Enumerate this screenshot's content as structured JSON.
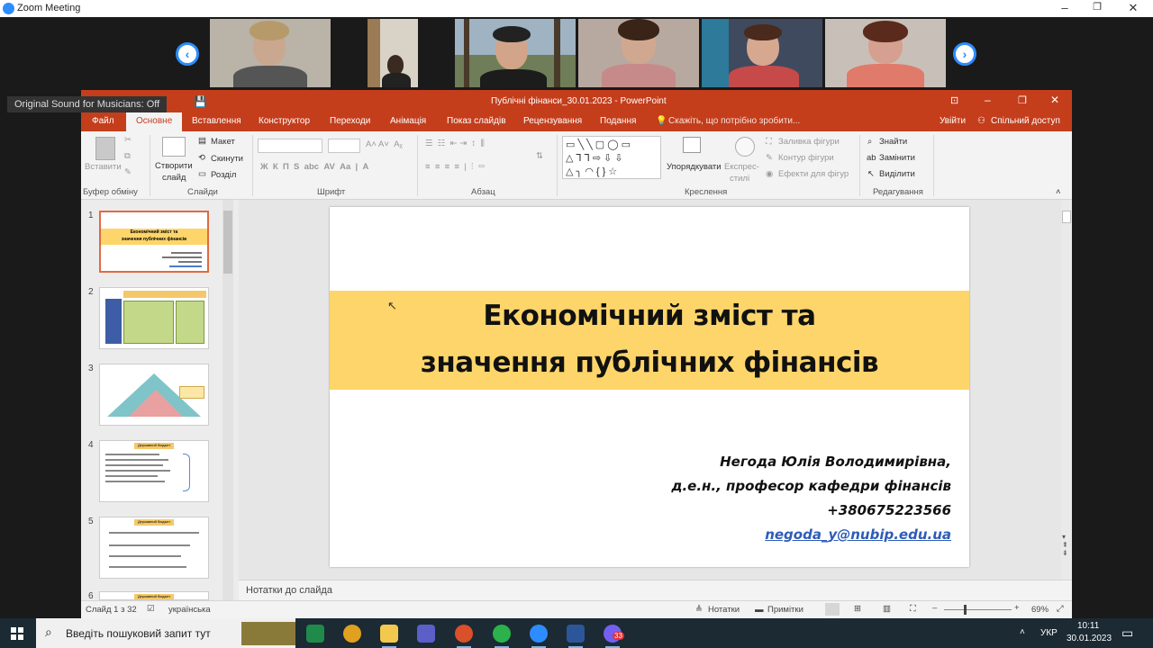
{
  "zoom": {
    "title": "Zoom Meeting",
    "win_min": "–",
    "win_max": "❐",
    "win_close": "✕",
    "prev": "‹",
    "next": "›",
    "tooltip": "Original Sound for Musicians: Off"
  },
  "ppt": {
    "title": "Публічні фінанси_30.01.2023  -  PowerPoint",
    "tabs": [
      "Файл",
      "Основне",
      "Вставлення",
      "Конструктор",
      "Переходи",
      "Анімація",
      "Показ слайдів",
      "Рецензування",
      "Подання"
    ],
    "tell_me": "Скажіть, що потрібно зробити...",
    "sign_in": "Увійти",
    "share": "Спільний доступ",
    "ribbon": {
      "paste": "Вставити",
      "clipboard_group": "Буфер обміну",
      "new_slide_1": "Створити",
      "new_slide_2": "слайд",
      "layout": "Макет",
      "reset": "Скинути",
      "section": "Розділ",
      "slides_group": "Слайди",
      "font_group": "Шрифт",
      "paragraph_group": "Абзац",
      "arrange": "Упорядкувати",
      "quick_styles_1": "Експрес-",
      "quick_styles_2": "стилі",
      "shape_fill": "Заливка фігури",
      "shape_outline": "Контур фігури",
      "shape_effects": "Ефекти для фігур",
      "drawing_group": "Креслення",
      "find": "Знайти",
      "replace": "Замінити",
      "select": "Виділити",
      "editing_group": "Редагування"
    },
    "thumb_numbers": [
      "1",
      "2",
      "3",
      "4",
      "5",
      "6"
    ],
    "thumb1_title_1": "Економічний зміст та",
    "thumb1_title_2": "значення публічних фінансів",
    "thumb_label": "Державний бюджет",
    "slide": {
      "title_line1": "Економічний зміст та",
      "title_line2": "значення публічних фінансів",
      "author_name": "Негода Юлія Володимирівна,",
      "author_position": "д.е.н., професор кафедри фінансів",
      "author_phone": "+380675223566",
      "author_email": "negoda_y@nubip.edu.ua"
    },
    "notes_placeholder": "Нотатки до слайда",
    "status": {
      "slide_count": "Слайд 1 з 32",
      "language": "українська",
      "notes": "Нотатки",
      "comments": "Примітки",
      "zoom": "69%"
    }
  },
  "taskbar": {
    "search_placeholder": "Введіть пошуковий запит тут",
    "lang": "УКР",
    "time": "10:11",
    "date": "30.01.2023",
    "badge": "33"
  },
  "colors": {
    "ppt_accent": "#c43e1c",
    "slide_band": "#fdd56a",
    "zoom_blue": "#2d8cff"
  }
}
